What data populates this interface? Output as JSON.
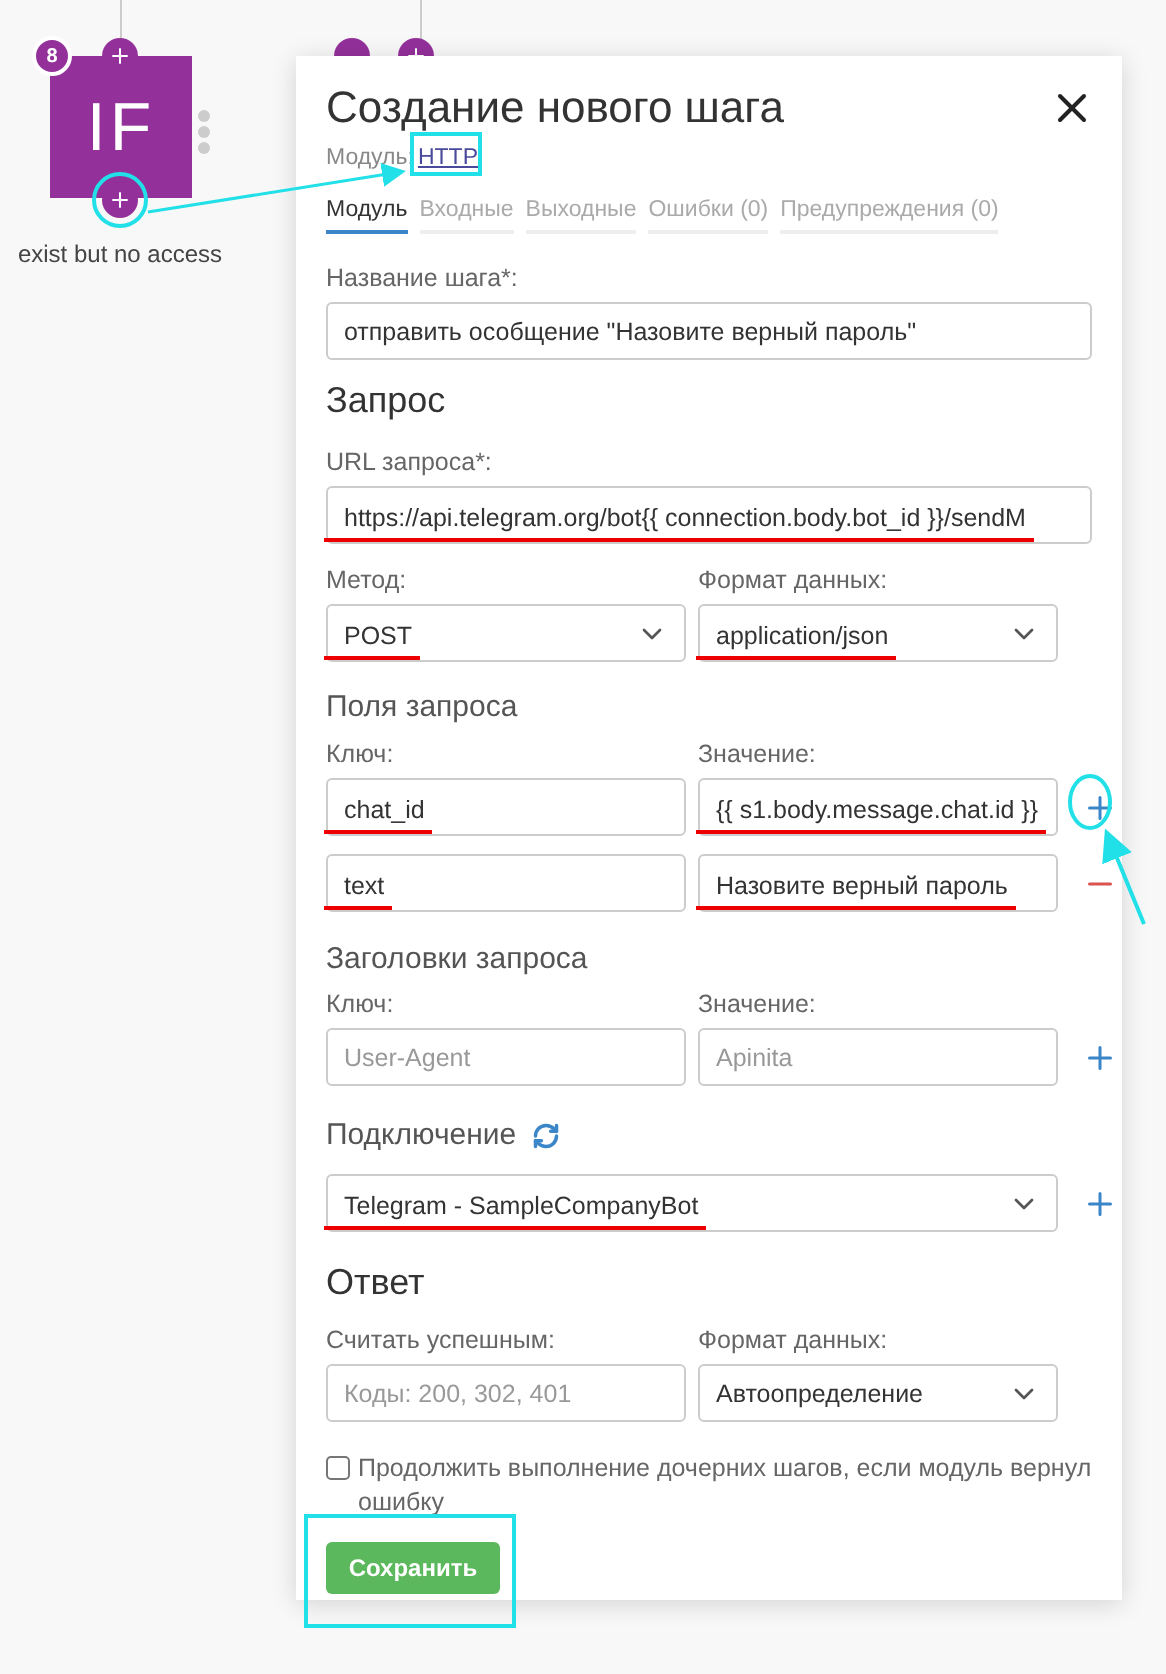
{
  "canvas": {
    "node": {
      "label": "IF",
      "badge": "8",
      "caption": "exist but no access"
    }
  },
  "dialog": {
    "title": "Создание нового шага",
    "module": {
      "label": "Модуль:",
      "link": "HTTP"
    },
    "tabs": [
      {
        "label": "Модуль",
        "selected": true
      },
      {
        "label": "Входные",
        "selected": false
      },
      {
        "label": "Выходные",
        "selected": false
      },
      {
        "label": "Ошибки (0)",
        "selected": false
      },
      {
        "label": "Предупреждения (0)",
        "selected": false
      }
    ],
    "step_name": {
      "label": "Название шага*:",
      "value": "отправить особщение \"Назовите верный пароль\"",
      "underlined": false
    },
    "request": {
      "heading": "Запрос",
      "url": {
        "label": "URL запроса*:",
        "value": "https://api.telegram.org/bot{{ connection.body.bot_id }}/sendM",
        "underlined": true
      },
      "method": {
        "label": "Метод:",
        "value": "POST",
        "underlined": true
      },
      "format": {
        "label": "Формат данных:",
        "value": "application/json",
        "underlined": true
      },
      "fields": {
        "heading": "Поля запроса",
        "key_label": "Ключ:",
        "value_label": "Значение:",
        "rows": [
          {
            "kind": "add",
            "key": {
              "value": "chat_id",
              "underlined": true
            },
            "value": {
              "value": "{{ s1.body.message.chat.id }}",
              "underlined": true
            }
          },
          {
            "kind": "remove",
            "key": {
              "value": "text",
              "underlined": true
            },
            "value": {
              "value": "Назовите верный пароль",
              "underlined": true
            }
          }
        ]
      },
      "headers": {
        "heading": "Заголовки запроса",
        "key_label": "Ключ:",
        "value_label": "Значение:",
        "rows": [
          {
            "kind": "add",
            "key": {
              "placeholder": "User-Agent"
            },
            "value": {
              "placeholder": "Apinita"
            }
          }
        ]
      },
      "connection": {
        "label": "Подключение",
        "value": "Telegram - SampleCompanyBot",
        "underlined": true
      }
    },
    "response": {
      "heading": "Ответ",
      "success": {
        "label": "Считать успешным:",
        "placeholder": "Коды: 200, 302, 401"
      },
      "format": {
        "label": "Формат данных:",
        "value": "Автоопределение",
        "underlined": false
      }
    },
    "continue_on_error": {
      "label": "Продолжить выполнение дочерних шагов, если модуль вернул ошибку",
      "checked": false
    },
    "save_button": "Сохранить"
  }
}
